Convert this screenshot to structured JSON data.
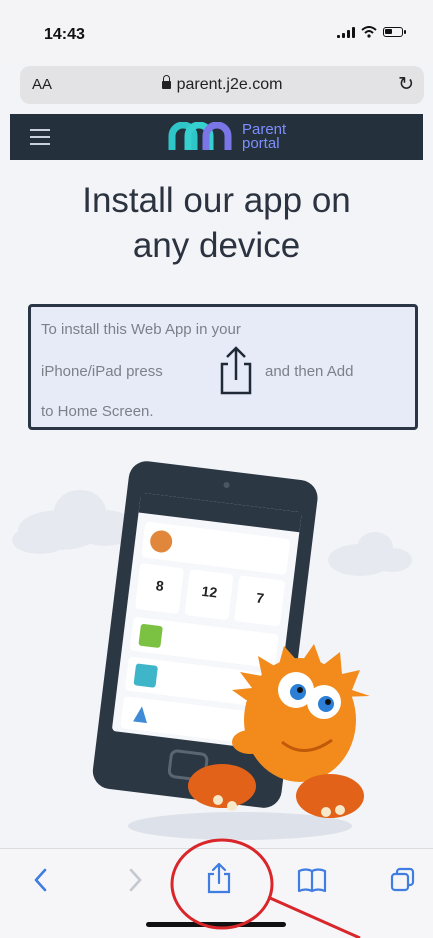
{
  "status_bar": {
    "time": "14:43"
  },
  "browser": {
    "text_size_button": "AA",
    "url": "parent.j2e.com"
  },
  "site": {
    "logo_line1": "Parent",
    "logo_line2": "portal"
  },
  "page": {
    "title_line1": "Install our app on",
    "title_line2": "any device",
    "instructions": {
      "line1": "To install this Web App in your",
      "line2_before": "iPhone/iPad press",
      "line2_after": "and then Add",
      "line3": "to Home Screen."
    }
  },
  "icons": {
    "share": "share-icon",
    "back": "chevron-left-icon",
    "forward": "chevron-right-icon",
    "bookmarks": "book-icon",
    "tabs": "tabs-icon",
    "reload": "reload-icon",
    "lock": "lock-icon"
  },
  "phone_screen": {
    "stats": [
      "8",
      "12",
      "7"
    ]
  },
  "colors": {
    "accent_blue": "#3f7de0",
    "header_dark": "#24303c",
    "annotation_red": "#d9262b",
    "mascot_orange": "#f28b1c"
  }
}
